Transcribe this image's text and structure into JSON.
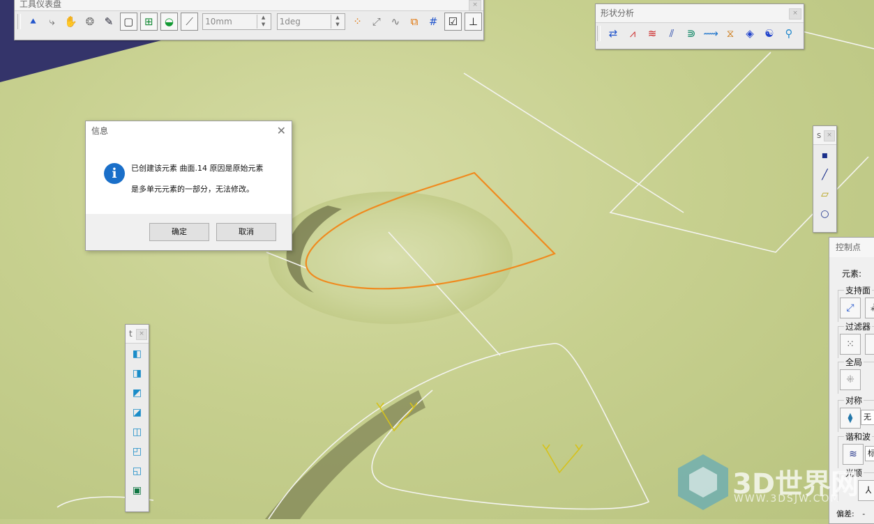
{
  "toolbar_dashboard": {
    "title": "工具仪表盘",
    "close": "×",
    "length_value": "10mm",
    "angle_value": "1deg"
  },
  "toolbar_shape": {
    "title": "形状分析",
    "close": "×"
  },
  "toolbar_small_right": {
    "title": "s",
    "close": "×"
  },
  "toolbar_small_left": {
    "title": "t",
    "close": "×"
  },
  "dialog": {
    "title": "信息",
    "close": "✕",
    "icon": "i",
    "message_line1": "已创建该元素 曲面.14 原因是原始元素",
    "message_line2": "是多单元元素的一部分，无法修改。",
    "ok_label": "确定",
    "cancel_label": "取消"
  },
  "control_points": {
    "title": "控制点",
    "element_label": "元素:",
    "support_label": "支持面",
    "filter_label": "过滤器",
    "global_label": "全局",
    "symmetry_label": "对称",
    "symmetry_value": "无",
    "harmonic_label": "谐和波",
    "harmonic_value": "标",
    "smooth_label": "光顺",
    "deviation_label": "偏差:",
    "deviation_value": "-"
  },
  "watermark": {
    "text": "3D世界网",
    "sub": "WWW.3DSJW.COM"
  },
  "colors": {
    "accent_curve": "#f08a1e",
    "info_blue": "#1a6fc9",
    "background": "#c7d08f"
  }
}
